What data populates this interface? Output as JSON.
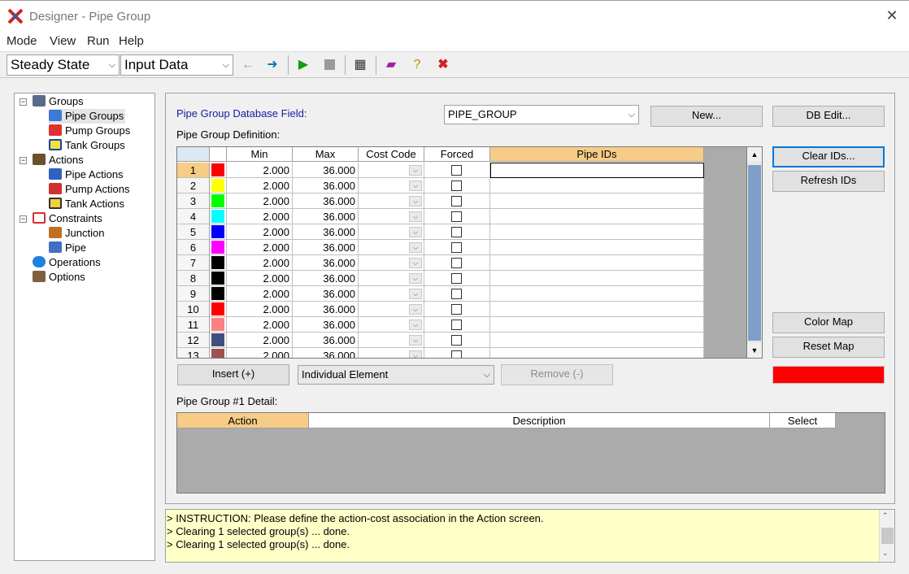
{
  "window": {
    "title": "Designer - Pipe Group",
    "close": "✕"
  },
  "menu": [
    "Mode",
    "View",
    "Run",
    "Help"
  ],
  "toolbar": {
    "mode_combo": "Steady State",
    "data_combo": "Input Data"
  },
  "tree": {
    "groups": "Groups",
    "pipe_groups": "Pipe Groups",
    "pump_groups": "Pump Groups",
    "tank_groups": "Tank Groups",
    "actions": "Actions",
    "pipe_actions": "Pipe Actions",
    "pump_actions": "Pump Actions",
    "tank_actions": "Tank Actions",
    "constraints": "Constraints",
    "junction": "Junction",
    "pipe": "Pipe",
    "operations": "Operations",
    "options": "Options"
  },
  "main": {
    "db_field_label": "Pipe Group Database Field:",
    "db_field_value": "PIPE_GROUP",
    "new_button": "New...",
    "db_edit_button": "DB Edit...",
    "definition_label": "Pipe Group Definition:",
    "clear_ids_button": "Clear IDs...",
    "refresh_ids_button": "Refresh IDs",
    "color_map_button": "Color Map",
    "reset_map_button": "Reset Map",
    "insert_button": "Insert (+)",
    "element_combo": "Individual Element",
    "remove_button": "Remove (-)",
    "detail_label": "Pipe Group #1 Detail:",
    "current_color": "#ff0000"
  },
  "grid": {
    "columns": [
      "Min",
      "Max",
      "Cost Code",
      "Forced",
      "Pipe IDs"
    ],
    "rows": [
      {
        "n": "1",
        "color": "#ff0000",
        "min": "2.000",
        "max": "36.000"
      },
      {
        "n": "2",
        "color": "#ffff00",
        "min": "2.000",
        "max": "36.000"
      },
      {
        "n": "3",
        "color": "#00ff00",
        "min": "2.000",
        "max": "36.000"
      },
      {
        "n": "4",
        "color": "#00ffff",
        "min": "2.000",
        "max": "36.000"
      },
      {
        "n": "5",
        "color": "#0000ff",
        "min": "2.000",
        "max": "36.000"
      },
      {
        "n": "6",
        "color": "#ff00ff",
        "min": "2.000",
        "max": "36.000"
      },
      {
        "n": "7",
        "color": "#000000",
        "min": "2.000",
        "max": "36.000"
      },
      {
        "n": "8",
        "color": "#000000",
        "min": "2.000",
        "max": "36.000"
      },
      {
        "n": "9",
        "color": "#000000",
        "min": "2.000",
        "max": "36.000"
      },
      {
        "n": "10",
        "color": "#ff0000",
        "min": "2.000",
        "max": "36.000"
      },
      {
        "n": "11",
        "color": "#ff8080",
        "min": "2.000",
        "max": "36.000"
      },
      {
        "n": "12",
        "color": "#3f4f7f",
        "min": "2.000",
        "max": "36.000"
      },
      {
        "n": "13",
        "color": "#a05050",
        "min": "2.000",
        "max": "36.000"
      }
    ]
  },
  "detail_grid": {
    "columns": [
      "Action",
      "Description",
      "Select"
    ]
  },
  "log": [
    "> INSTRUCTION: Please define the action-cost association in the Action screen.",
    "> Clearing 1 selected group(s) ... done.",
    "> Clearing 1 selected group(s) ... done."
  ]
}
